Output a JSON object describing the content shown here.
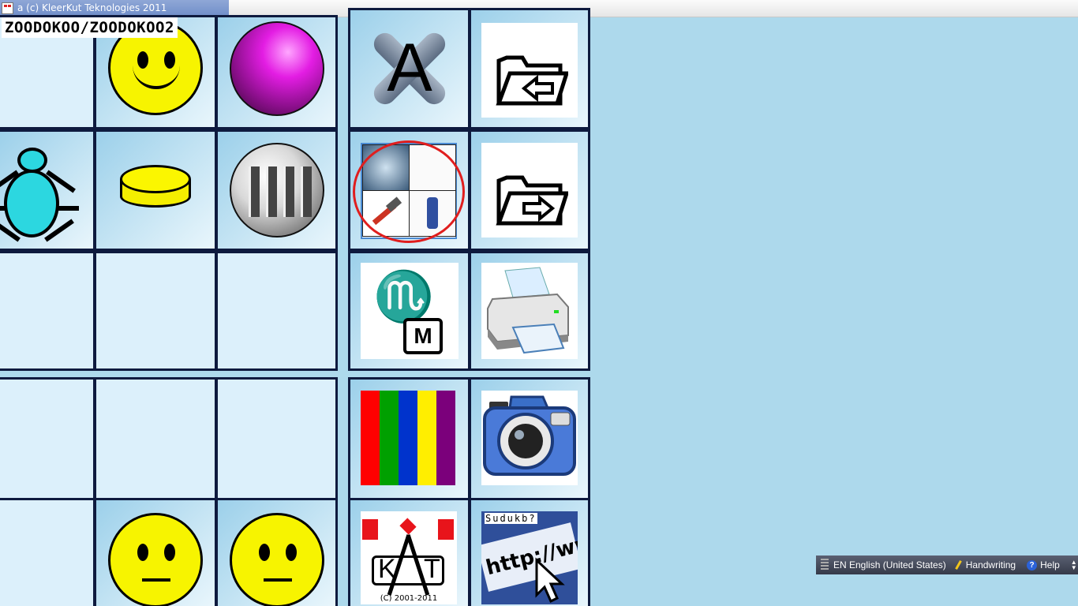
{
  "window": {
    "title": "a (c) KleerKut Teknologies 2011",
    "user_label": "ZOODOKOO/ZOODOKOO2"
  },
  "tiles": {
    "col1": [
      "blank",
      "bug-icon",
      "blank",
      "blank",
      "blank"
    ],
    "col2": [
      "smiley-icon",
      "coin-icon",
      "blank",
      "blank",
      "neutral-face-icon"
    ],
    "col3": [
      "purple-sphere-icon",
      "tin-icon",
      "blank",
      "blank",
      "neutral-face-icon"
    ],
    "col4": [
      "x-logo-icon",
      "tools-grid-icon",
      "scorpio-m-icon",
      "rainbow-icon",
      "kat-logo-icon"
    ],
    "col5": [
      "folder-back-icon",
      "folder-forward-icon",
      "printer-icon",
      "camera-icon",
      "sudoku-web-icon"
    ]
  },
  "icons": {
    "x_logo_letter": "A",
    "scorpio_symbol": "♏",
    "m_box": "M",
    "kat_left": "K",
    "kat_right": "T",
    "kat_caption": "(C) 2001-2011",
    "sudoku_word": "Sudukb?",
    "sudoku_url": "http://www"
  },
  "colors": {
    "background": "#add9ec",
    "cell_border": "#0e1a3e",
    "highlight_ring": "#e01e1e",
    "rainbow": [
      "#ff0000",
      "#00a000",
      "#0033cc",
      "#ffee00",
      "#7b007b"
    ]
  },
  "language_bar": {
    "language": "EN English (United States)",
    "handwriting": "Handwriting",
    "help": "Help"
  }
}
